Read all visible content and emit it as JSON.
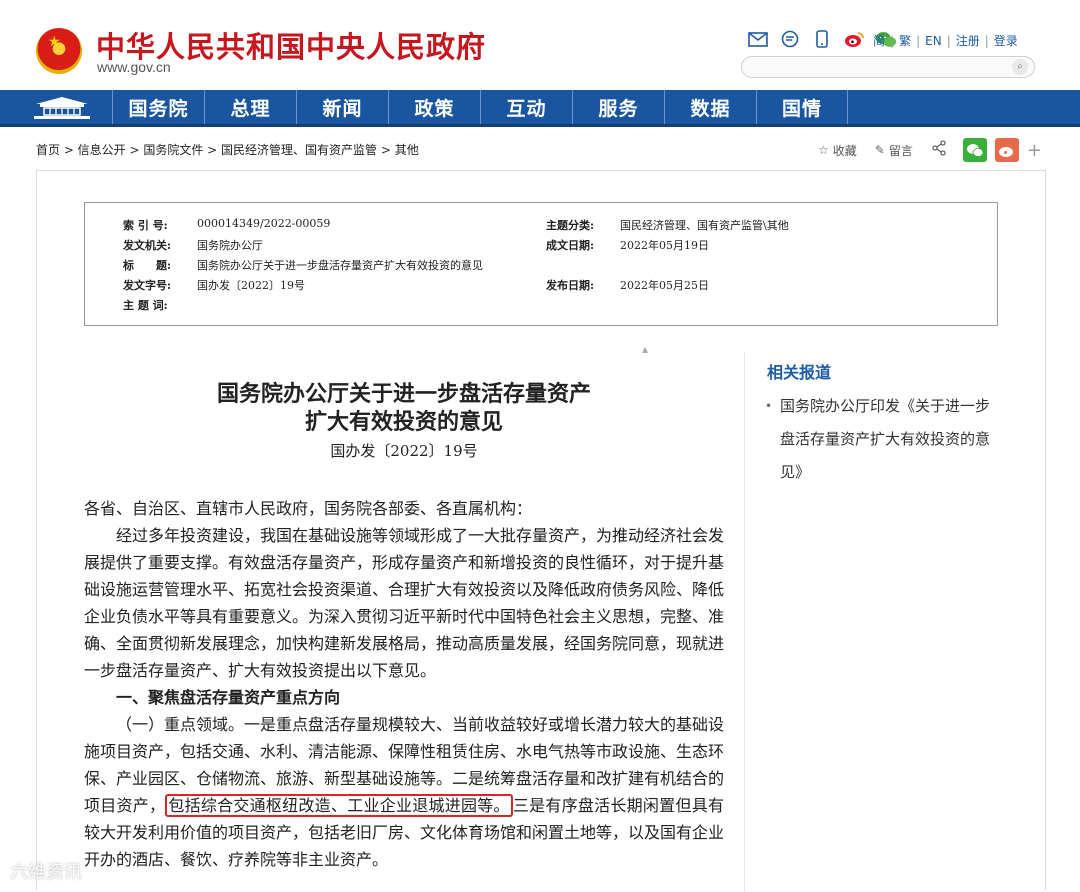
{
  "header": {
    "site_title": "中华人民共和国中央人民政府",
    "site_url": "www.gov.cn",
    "icons": [
      "mail-icon",
      "message-icon",
      "mobile-icon",
      "weibo-icon",
      "wechat-icon"
    ],
    "lang_links": [
      "简",
      "繁",
      "EN",
      "注册",
      "登录"
    ],
    "search_placeholder": ""
  },
  "nav": {
    "items": [
      "国务院",
      "总理",
      "新闻",
      "政策",
      "互动",
      "服务",
      "数据",
      "国情"
    ]
  },
  "breadcrumb": "首页 > 信息公开 > 国务院文件 > 国民经济管理、国有资产监管 > 其他",
  "tools": {
    "favorite": "收藏",
    "comment": "留言"
  },
  "meta": {
    "index_label": "索 引 号:",
    "index_value": "000014349/2022-00059",
    "topic_label": "主题分类:",
    "topic_value": "国民经济管理、国有资产监管\\其他",
    "issuer_label": "发文机关:",
    "issuer_value": "国务院办公厅",
    "date_label": "成文日期:",
    "date_value": "2022年05月19日",
    "title_label": "标　　题:",
    "title_value": "国务院办公厅关于进一步盘活存量资产扩大有效投资的意见",
    "docno_label": "发文字号:",
    "docno_value": "国办发〔2022〕19号",
    "publish_label": "发布日期:",
    "publish_value": "2022年05月25日",
    "keywords_label": "主 题 词:",
    "keywords_value": ""
  },
  "document": {
    "title_line1": "国务院办公厅关于进一步盘活存量资产",
    "title_line2": "扩大有效投资的意见",
    "number": "国办发〔2022〕19号",
    "salutation": "各省、自治区、直辖市人民政府，国务院各部委、各直属机构：",
    "para1": "经过多年投资建设，我国在基础设施等领域形成了一大批存量资产，为推动经济社会发展提供了重要支撑。有效盘活存量资产，形成存量资产和新增投资的良性循环，对于提升基础设施运营管理水平、拓宽社会投资渠道、合理扩大有效投资以及降低政府债务风险、降低企业负债水平等具有重要意义。为深入贯彻习近平新时代中国特色社会主义思想，完整、准确、全面贯彻新发展理念，加快构建新发展格局，推动高质量发展，经国务院同意，现就进一步盘活存量资产、扩大有效投资提出以下意见。",
    "section1": "一、聚焦盘活存量资产重点方向",
    "para2_a": "（一）重点领域。一是重点盘活存量规模较大、当前收益较好或增长潜力较大的基础设施项目资产，包括交通、水利、清洁能源、保障性租赁住房、水电气热等市政设施、生态环保、产业园区、仓储物流、旅游、新型基础设施等。二是统筹盘活存量和改扩建有机结合的项目资产，",
    "para2_highlight": "包括综合交通枢纽改造、工业企业退城进园等。",
    "para2_b": "三是有序盘活长期闲置但具有较大开发利用价值的项目资产，包括老旧厂房、文化体育场馆和闲置土地等，以及国有企业开办的酒店、餐饮、疗养院等非主业资产。"
  },
  "sidebar": {
    "title": "相关报道",
    "item": "国务院办公厅印发《关于进一步盘活存量资产扩大有效投资的意见》"
  },
  "watermark": "六维资讯"
}
